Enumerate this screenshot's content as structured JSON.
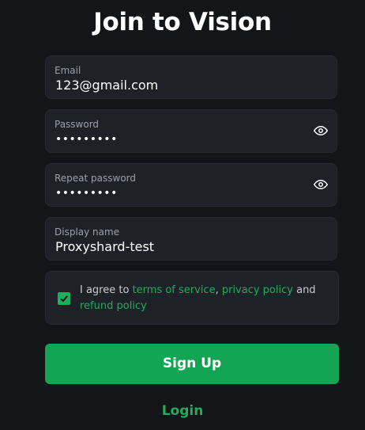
{
  "page": {
    "title": "Join to Vision"
  },
  "form": {
    "email": {
      "label": "Email",
      "value": "123@gmail.com"
    },
    "password": {
      "label": "Password",
      "value": "•••••••••",
      "icon": "eye-icon"
    },
    "repeat_password": {
      "label": "Repeat password",
      "value": "•••••••••",
      "icon": "eye-icon"
    },
    "display_name": {
      "label": "Display name",
      "value": "Proxyshard-test"
    },
    "agreement": {
      "checked": true,
      "prefix": "I agree to ",
      "terms_link": "terms of service",
      "sep1": ", ",
      "privacy_link": "privacy policy",
      "sep2": " and ",
      "refund_link": "refund policy"
    },
    "signup_label": "Sign Up",
    "login_label": "Login"
  },
  "colors": {
    "background": "#141518",
    "field_bg": "#1e2128",
    "accent": "#1fae5a",
    "button": "#13a553"
  }
}
